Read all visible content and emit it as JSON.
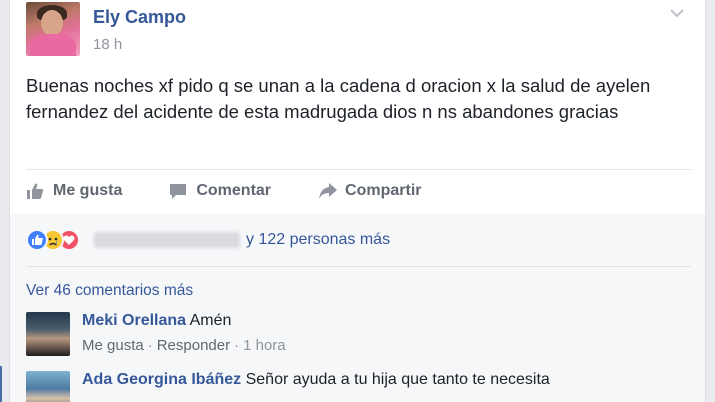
{
  "post": {
    "author": "Ely Campo",
    "time": "18 h",
    "text": "Buenas noches xf pido q se unan a la cadena d oracion x la salud de ayelen fernandez del acidente de esta madrugada dios n ns abandones gracias"
  },
  "actions": {
    "like": "Me gusta",
    "comment": "Comentar",
    "share": "Compartir"
  },
  "reactions": {
    "icons": [
      "like-icon",
      "sad-icon",
      "love-icon"
    ],
    "others_text": "y 122 personas más"
  },
  "comments_section": {
    "more_label": "Ver 46 comentarios más",
    "comments": [
      {
        "name": "Meki Orellana",
        "text": "Amén",
        "like_label": "Me gusta",
        "reply_label": "Responder",
        "time": "1 hora"
      },
      {
        "name": "Ada Georgina Ibáñez",
        "text": "Señor ayuda a tu hija que tanto te necesita"
      }
    ]
  },
  "colors": {
    "link_blue": "#365899",
    "like_blue": "#4080ff",
    "sad_yellow": "#f7c631",
    "love_red": "#f25268"
  }
}
